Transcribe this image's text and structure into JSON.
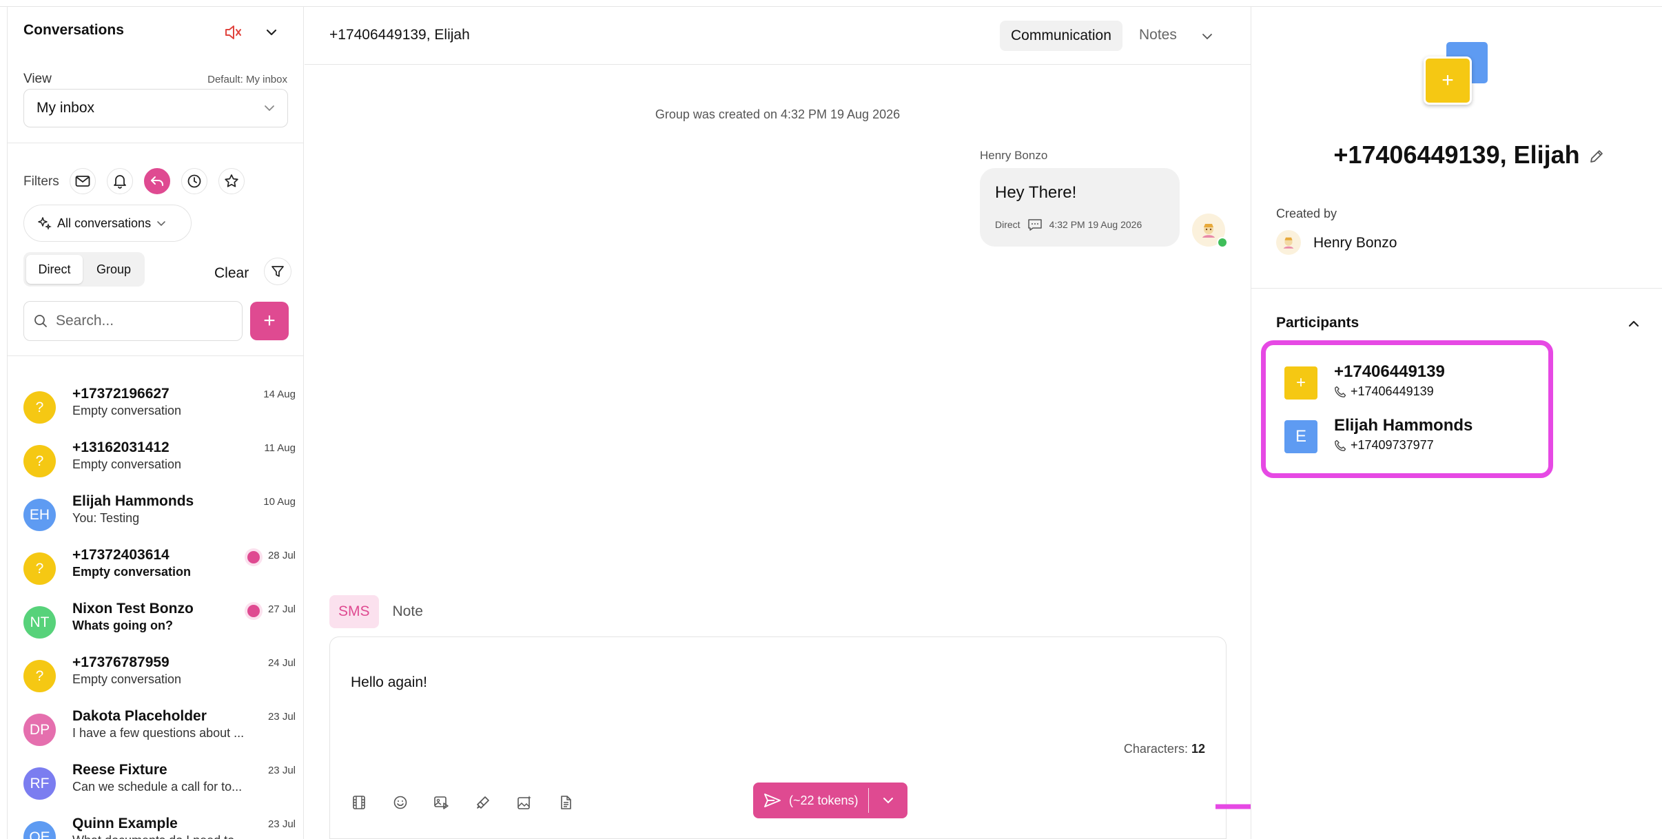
{
  "sidebar": {
    "title": "Conversations",
    "view_label": "View",
    "view_default": "Default: My inbox",
    "view_value": "My inbox",
    "filters_label": "Filters",
    "all_conversations": "All conversations",
    "segment": {
      "direct": "Direct",
      "group": "Group",
      "active": "Direct"
    },
    "clear_label": "Clear",
    "search_placeholder": "Search...",
    "add_label": "+",
    "conversations": [
      {
        "initials": "?",
        "name": "+17372196627",
        "preview": "Empty conversation",
        "date": "14 Aug",
        "color": "#f5c813",
        "unread": false
      },
      {
        "initials": "?",
        "name": "+13162031412",
        "preview": "Empty conversation",
        "date": "11 Aug",
        "color": "#f5c813",
        "unread": false
      },
      {
        "initials": "EH",
        "name": "Elijah Hammonds",
        "preview": "You: Testing",
        "date": "10 Aug",
        "color": "#5e9bf2",
        "unread": false
      },
      {
        "initials": "?",
        "name": "+17372403614",
        "preview": "Empty conversation",
        "date": "28 Jul",
        "color": "#f5c813",
        "unread": true
      },
      {
        "initials": "NT",
        "name": "Nixon Test Bonzo",
        "preview": "Whats going on?",
        "date": "27 Jul",
        "color": "#57d27a",
        "unread": true
      },
      {
        "initials": "?",
        "name": "+17376787959",
        "preview": "Empty conversation",
        "date": "24 Jul",
        "color": "#f5c813",
        "unread": false
      },
      {
        "initials": "DP",
        "name": "Dakota Placeholder",
        "preview": "I have a few questions about ...",
        "date": "23 Jul",
        "color": "#e56fae",
        "unread": false
      },
      {
        "initials": "RF",
        "name": "Reese Fixture",
        "preview": "Can we schedule a call for to...",
        "date": "23 Jul",
        "color": "#7b7df0",
        "unread": false
      },
      {
        "initials": "QE",
        "name": "Quinn Example",
        "preview": "What documents do I need to ...",
        "date": "23 Jul",
        "color": "#5e9bf2",
        "unread": false
      }
    ]
  },
  "middle": {
    "title": "+17406449139, Elijah",
    "tabs": {
      "communication": "Communication",
      "notes": "Notes"
    },
    "system_message": "Group was created on 4:32 PM 19 Aug 2026",
    "message": {
      "sender": "Henry Bonzo",
      "text": "Hey There!",
      "channel": "Direct",
      "time": "4:32 PM 19 Aug 2026"
    },
    "composer": {
      "tab_sms": "SMS",
      "tab_note": "Note",
      "text": "Hello again!",
      "char_label": "Characters:",
      "char_count": "12",
      "send_label": "(~22 tokens)"
    }
  },
  "right": {
    "group_initial": "+",
    "title": "+17406449139, Elijah",
    "created_by_label": "Created by",
    "creator": "Henry Bonzo",
    "participants_label": "Participants",
    "participants": [
      {
        "initial": "+",
        "name": "+17406449139",
        "phone": "+17406449139",
        "color": "#f5c813"
      },
      {
        "initial": "E",
        "name": "Elijah Hammonds",
        "phone": "+17409737977",
        "color": "#5e9bf2"
      }
    ]
  },
  "colors": {
    "accent": "#df4a91",
    "annotation": "#e649e4",
    "online": "#3fbe5a"
  }
}
